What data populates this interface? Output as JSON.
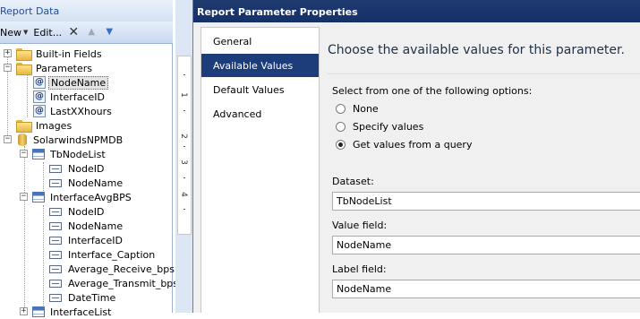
{
  "report_data": {
    "title": "Report Data",
    "toolbar": {
      "new_label": "New",
      "edit_label": "Edit..."
    },
    "tree": {
      "built_in_fields": "Built-in Fields",
      "parameters": "Parameters",
      "param_items": [
        "NodeName",
        "InterfaceID",
        "LastXXhours"
      ],
      "images": "Images",
      "datasource": "SolarwindsNPMDB",
      "dataset1": {
        "name": "TbNodeList",
        "fields": [
          "NodeID",
          "NodeName"
        ]
      },
      "dataset2": {
        "name": "InterfaceAvgBPS",
        "fields": [
          "NodeID",
          "NodeName",
          "InterfaceID",
          "Interface_Caption",
          "Average_Receive_bps",
          "Average_Transmit_bps",
          "DateTime"
        ]
      },
      "dataset3": {
        "name": "InterfaceList"
      }
    }
  },
  "ruler": {
    "marks": [
      "1",
      "2",
      "3",
      "4"
    ]
  },
  "dialog": {
    "title": "Report Parameter Properties",
    "nav": [
      "General",
      "Available Values",
      "Default Values",
      "Advanced"
    ],
    "heading": "Choose the available values for this parameter.",
    "options_label": "Select from one of the following options:",
    "options": [
      "None",
      "Specify values",
      "Get values from a query"
    ],
    "selected_option": "Get values from a query",
    "dataset_label": "Dataset:",
    "dataset_value": "TbNodeList",
    "value_field_label": "Value field:",
    "value_field_value": "NodeName",
    "label_field_label": "Label field:",
    "label_field_value": "NodeName"
  },
  "colors": {
    "title_bar": "#16306a",
    "nav_selected": "#1c3d7a",
    "pane_header_text": "#1f4e97"
  }
}
